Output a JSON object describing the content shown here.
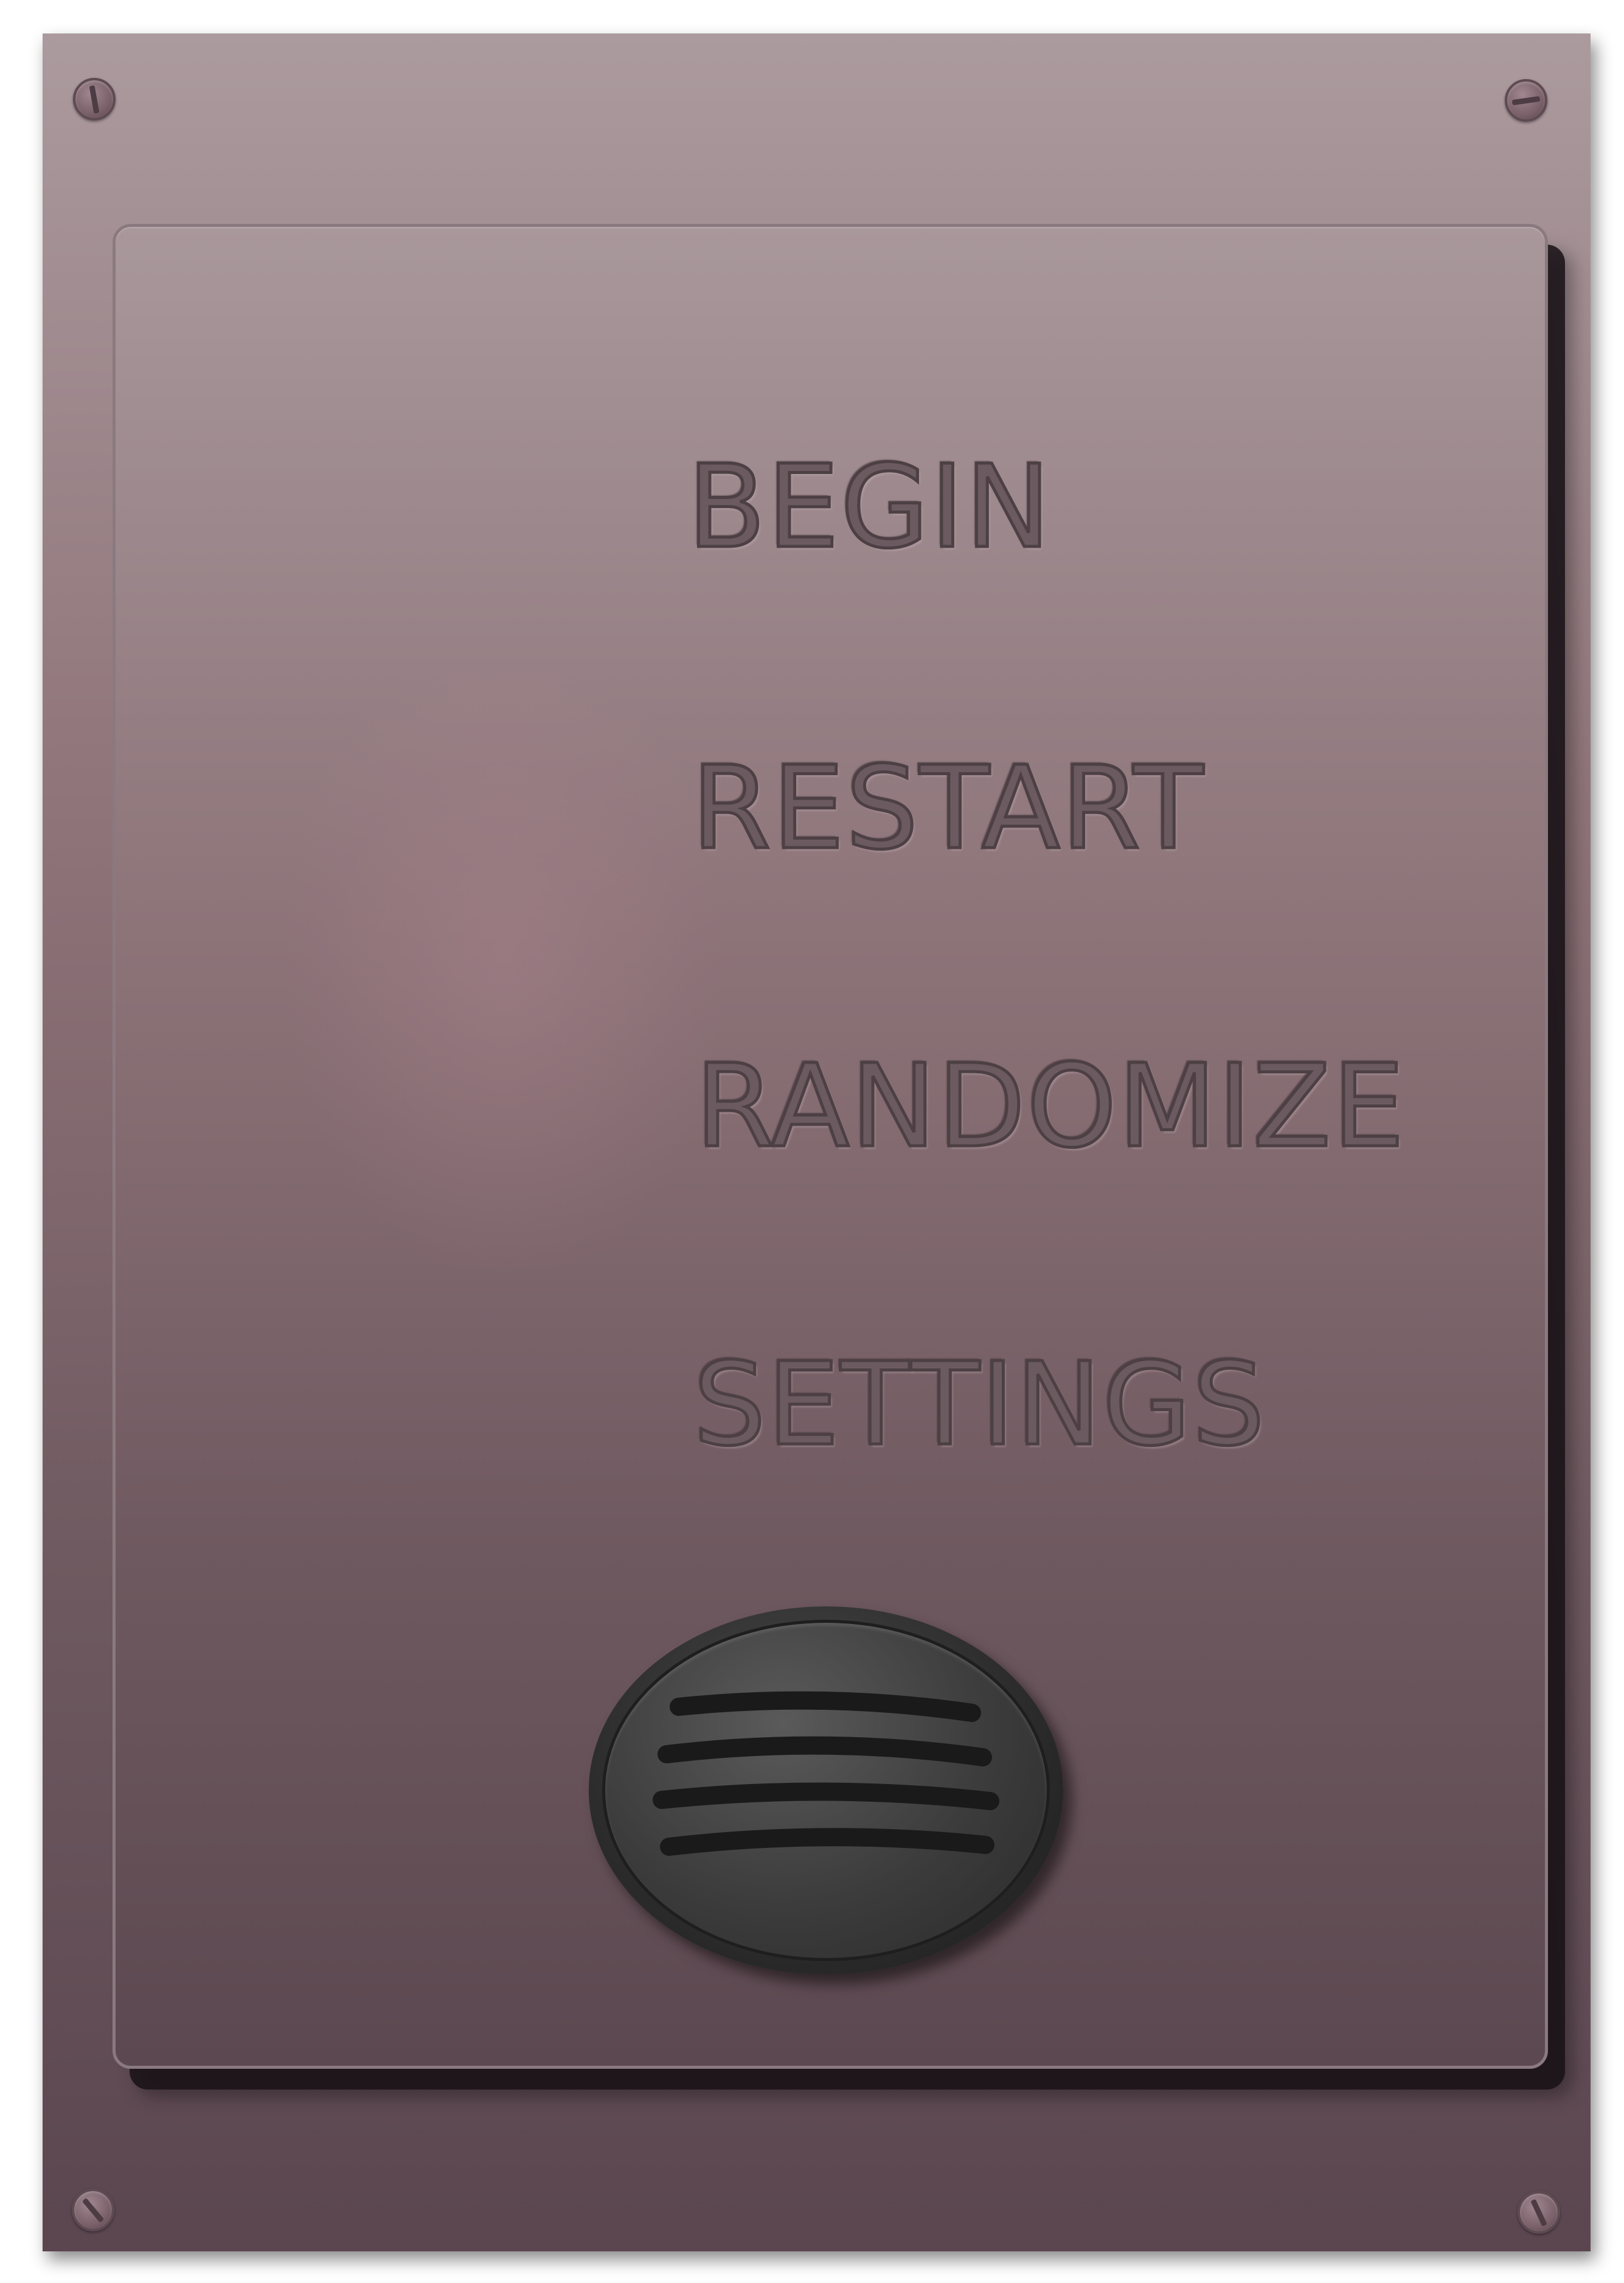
{
  "menu": {
    "items": [
      {
        "label": "BEGIN"
      },
      {
        "label": "RESTART"
      },
      {
        "label": "RANDOMIZE"
      },
      {
        "label": "SETTINGS"
      }
    ]
  },
  "icons": {
    "screws": [
      "screw-icon",
      "screw-icon",
      "screw-icon",
      "screw-icon"
    ],
    "speaker": "speaker-grille-icon"
  },
  "colors": {
    "plate_top": "#ab9a9e",
    "plate_bottom": "#5b4650",
    "label_fill": "#6b5a60",
    "speaker": "#2e2e2e"
  }
}
